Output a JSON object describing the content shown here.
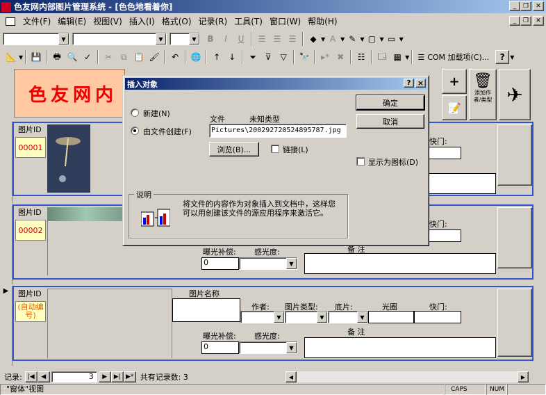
{
  "window": {
    "title": "色友网内部图片管理系统 - [色色地看着你]"
  },
  "menu": [
    "文件(F)",
    "编辑(E)",
    "视图(V)",
    "插入(I)",
    "格式(O)",
    "记录(R)",
    "工具(T)",
    "窗口(W)",
    "帮助(H)"
  ],
  "toolbar": {
    "com_addins": "COM 加载项(C)...",
    "help_glyph": "?"
  },
  "form": {
    "banner": "色友网内",
    "labels": {
      "pic_id": "图片ID",
      "pic_name": "图片名称",
      "author": "作者:",
      "pic_type": "图片类型:",
      "film": "底片:",
      "aperture": "光圈",
      "shutter": "快门:",
      "exposure": "曝光补偿:",
      "iso": "感光度:",
      "remarks": "备    注",
      "add_author_type": "添加作者/类型"
    },
    "records": [
      {
        "id": "00001",
        "exposure": ""
      },
      {
        "id": "00002",
        "exposure": "0"
      },
      {
        "id": "(自动编号)",
        "exposure": "0"
      }
    ]
  },
  "dialog": {
    "title": "插入对象",
    "help": "?",
    "close": "×",
    "radio_new": "新建(N)",
    "radio_file": "由文件创建(F)",
    "file_label": "文件",
    "file_type": "未知类型",
    "file_path": "Pictures\\200292720524895787.jpg",
    "browse": "浏览(B)...",
    "link": "链接(L)",
    "ok": "确定",
    "cancel": "取消",
    "display_icon": "显示为图标(D)",
    "desc_title": "说明",
    "desc_text": "将文件的内容作为对象插入到文档中，这样您可以用创建该文件的源应用程序来激活它。"
  },
  "navigation": {
    "label": "记录:",
    "current": "3",
    "total_text": "共有记录数: 3"
  },
  "status": {
    "view": "\"窗体\"视图",
    "caps": "CAPS",
    "num": "NUM"
  }
}
